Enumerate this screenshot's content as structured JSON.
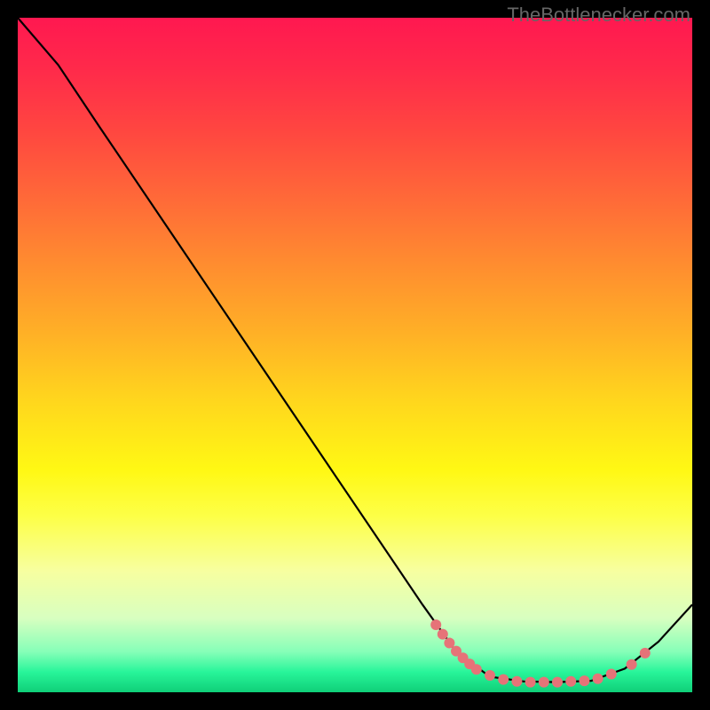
{
  "watermark": "TheBottlenecker.com",
  "chart_data": {
    "type": "line",
    "title": "",
    "xlabel": "",
    "ylabel": "",
    "xlim": [
      0,
      100
    ],
    "ylim": [
      0,
      100
    ],
    "curve": [
      {
        "x": 0,
        "y": 100
      },
      {
        "x": 6,
        "y": 93
      },
      {
        "x": 12,
        "y": 84
      },
      {
        "x": 60,
        "y": 13
      },
      {
        "x": 65,
        "y": 6
      },
      {
        "x": 70,
        "y": 2.3
      },
      {
        "x": 75,
        "y": 1.6
      },
      {
        "x": 80,
        "y": 1.5
      },
      {
        "x": 85,
        "y": 1.7
      },
      {
        "x": 90,
        "y": 3.5
      },
      {
        "x": 95,
        "y": 7.5
      },
      {
        "x": 100,
        "y": 13
      }
    ],
    "markers": [
      {
        "x": 62,
        "y": 10
      },
      {
        "x": 63,
        "y": 8.6
      },
      {
        "x": 64,
        "y": 7.3
      },
      {
        "x": 65,
        "y": 6.1
      },
      {
        "x": 66,
        "y": 5.1
      },
      {
        "x": 67,
        "y": 4.2
      },
      {
        "x": 68,
        "y": 3.4
      },
      {
        "x": 70,
        "y": 2.5
      },
      {
        "x": 72,
        "y": 1.9
      },
      {
        "x": 74,
        "y": 1.6
      },
      {
        "x": 76,
        "y": 1.5
      },
      {
        "x": 78,
        "y": 1.5
      },
      {
        "x": 80,
        "y": 1.5
      },
      {
        "x": 82,
        "y": 1.6
      },
      {
        "x": 84,
        "y": 1.7
      },
      {
        "x": 86,
        "y": 2.0
      },
      {
        "x": 88,
        "y": 2.7
      },
      {
        "x": 91,
        "y": 4.1
      },
      {
        "x": 93,
        "y": 5.8
      }
    ],
    "colors": {
      "curve": "#000000",
      "markers": "#e67378"
    }
  }
}
